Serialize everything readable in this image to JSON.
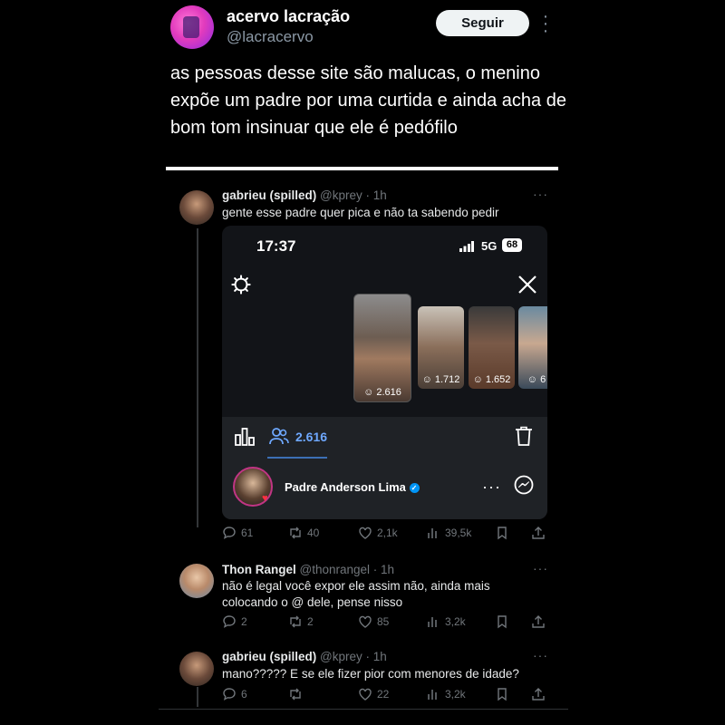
{
  "tweet": {
    "display_name": "acervo lacração",
    "handle": "@lacracervo",
    "follow_label": "Seguir",
    "text": "as pessoas desse site são malucas, o menino expõe um padre por uma curtida e ainda acha de bom tom insinuar que ele é pedófilo"
  },
  "replies": [
    {
      "name": "gabrieu (spilled)",
      "handle": "@kprey",
      "time": "· 1h",
      "text": "gente esse padre quer pica e não ta sabendo pedir",
      "actions": {
        "replies": "61",
        "retweets": "40",
        "likes": "2,1k",
        "views": "39,5k"
      }
    },
    {
      "name": "Thon Rangel",
      "handle": "@thonrangel",
      "time": "· 1h",
      "text": "não é legal você expor ele assim não, ainda mais colocando o @ dele, pense nisso",
      "actions": {
        "replies": "2",
        "retweets": "2",
        "likes": "85",
        "views": "3,2k"
      }
    },
    {
      "name": "gabrieu (spilled)",
      "handle": "@kprey",
      "time": "· 1h",
      "text": "mano????? E se ele fizer pior com menores de idade?",
      "actions": {
        "replies": "6",
        "retweets": "",
        "likes": "22",
        "views": "3,2k"
      }
    }
  ],
  "embed": {
    "status_time": "17:37",
    "network": "5G",
    "battery": "68",
    "stories": [
      {
        "count": "2.616"
      },
      {
        "count": "1.712"
      },
      {
        "count": "1.652"
      },
      {
        "count": "6"
      }
    ],
    "viewers_count": "2.616",
    "viewer_name": "Padre Anderson Lima"
  }
}
